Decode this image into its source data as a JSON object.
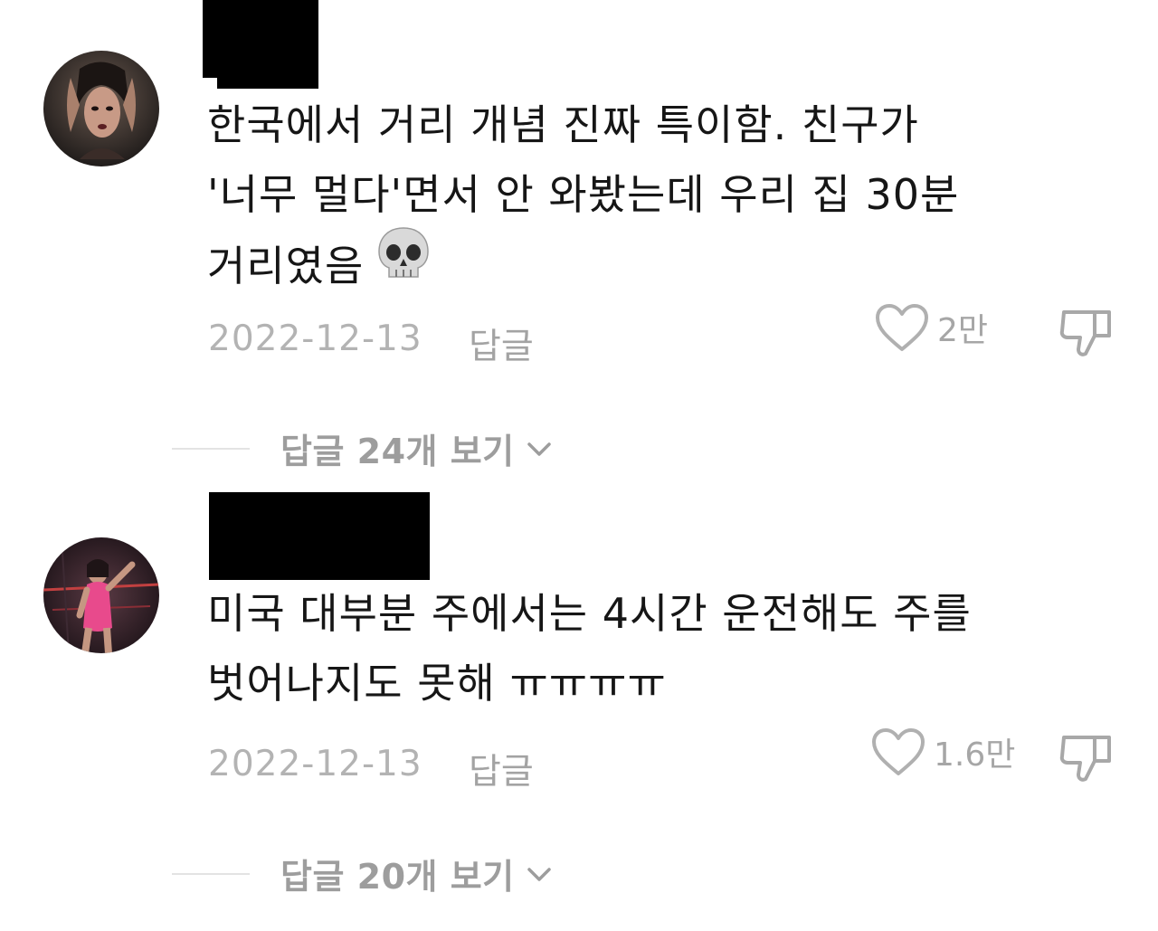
{
  "comments": [
    {
      "text_lines": [
        "한국에서 거리 개념 진짜 특이함. 친구가",
        "'너무 멀다'면서 안 와봤는데 우리 집 30분",
        "거리였음"
      ],
      "emoji": "skull-emoji",
      "date": "2022-12-13",
      "reply_label": "답글",
      "like_count": "2만",
      "view_replies": "답글 24개 보기"
    },
    {
      "text_lines": [
        "미국 대부분 주에서는 4시간 운전해도 주를",
        "벗어나지도 못해 ㅠㅠㅠㅠ"
      ],
      "date": "2022-12-13",
      "reply_label": "답글",
      "like_count": "1.6만",
      "view_replies": "답글 20개 보기"
    }
  ],
  "icons": {
    "heart": "heart-outline-icon",
    "dislike": "thumbs-down-outline-icon",
    "chevron": "chevron-down-icon"
  },
  "colors": {
    "text": "#161616",
    "meta": "#b3b3b3",
    "icon": "#a6a6a6"
  }
}
